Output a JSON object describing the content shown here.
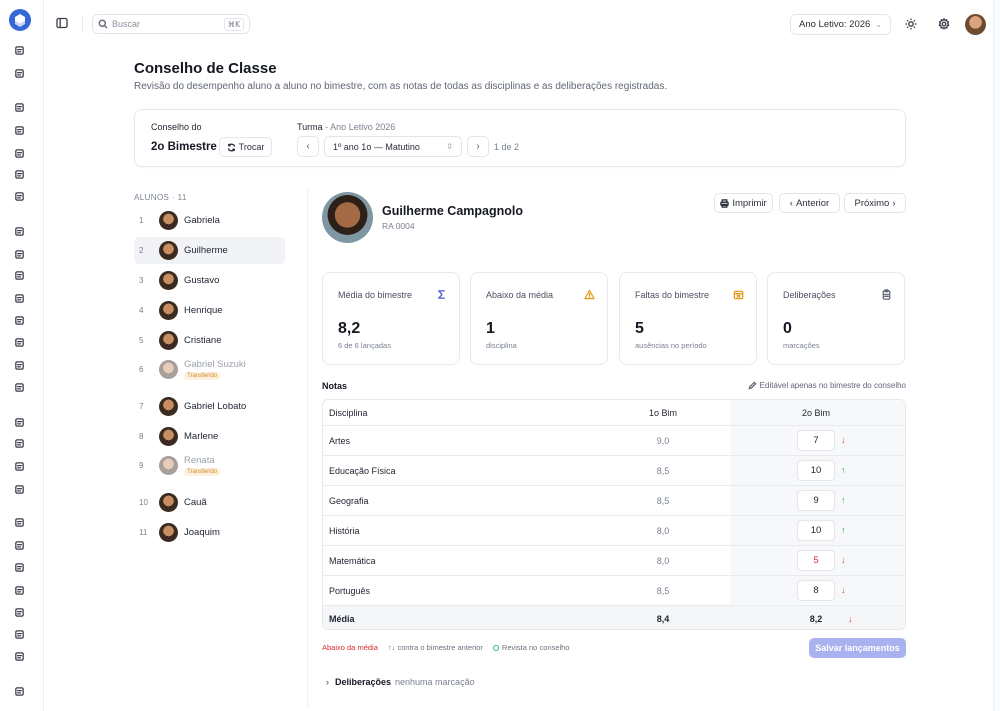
{
  "topbar": {
    "search_placeholder": "Buscar",
    "search_shortcut": "⌘K",
    "year_select": "Ano Letivo: 2026"
  },
  "header": {
    "title": "Conselho de Classe",
    "subtitle": "Revisão do desempenho aluno a aluno no bimestre, com as notas de todas as disciplinas e as deliberações registradas."
  },
  "context": {
    "conselho_label": "Conselho do",
    "conselho_value": "2o Bimestre",
    "swap_label": "Trocar",
    "turma_label": "Turma",
    "turma_suffix": " - Ano Letivo 2026",
    "turma_select": "1º ano 1o — Matutino",
    "page_count": "1 de 2"
  },
  "students": {
    "heading": "ALUNOS · 11",
    "items": [
      {
        "num": "1",
        "name": "Gabriela"
      },
      {
        "num": "2",
        "name": "Guilherme"
      },
      {
        "num": "3",
        "name": "Gustavo"
      },
      {
        "num": "4",
        "name": "Henrique"
      },
      {
        "num": "5",
        "name": "Cristiane"
      },
      {
        "num": "6",
        "name": "Gabriel Suzuki",
        "badge": "Transferido"
      },
      {
        "num": "7",
        "name": "Gabriel Lobato"
      },
      {
        "num": "8",
        "name": "Marlene"
      },
      {
        "num": "9",
        "name": "Renata",
        "badge": "Transferido"
      },
      {
        "num": "10",
        "name": "Cauã"
      },
      {
        "num": "11",
        "name": "Joaquim"
      }
    ]
  },
  "student": {
    "name": "Guilherme Campagnolo",
    "ra": "RA 0004",
    "print_label": "Imprimir",
    "prev_label": "Anterior",
    "next_label": "Próximo"
  },
  "metrics": [
    {
      "title": "Média do bimestre",
      "value": "8,2",
      "sub": "6 de 6 lançadas",
      "icon": "sigma-icon",
      "color": "#4a56c8"
    },
    {
      "title": "Abaixo da média",
      "value": "1",
      "sub": "disciplina",
      "icon": "warning-icon",
      "color": "#e59a1c"
    },
    {
      "title": "Faltas do bimestre",
      "value": "5",
      "sub": "ausências no período",
      "icon": "calendar-x-icon",
      "color": "#e59a1c"
    },
    {
      "title": "Deliberações",
      "value": "0",
      "sub": "marcações",
      "icon": "clipboard-icon",
      "color": "#5f6675"
    }
  ],
  "grades": {
    "title": "Notas",
    "hint": "Editável apenas no bimestre do conselho",
    "headers": {
      "discipline": "Disciplina",
      "b1": "1o Bim",
      "b2": "2o Bim"
    },
    "rows": [
      {
        "discipline": "Artes",
        "b1": "9,0",
        "b2": "7",
        "trend": "↓",
        "dir": "down",
        "low": false
      },
      {
        "discipline": "Educação Física",
        "b1": "8,5",
        "b2": "10",
        "trend": "↑",
        "dir": "up",
        "low": false
      },
      {
        "discipline": "Geografia",
        "b1": "8,5",
        "b2": "9",
        "trend": "↑",
        "dir": "up",
        "low": false
      },
      {
        "discipline": "História",
        "b1": "8,0",
        "b2": "10",
        "trend": "↑",
        "dir": "up",
        "low": false
      },
      {
        "discipline": "Matemática",
        "b1": "8,0",
        "b2": "5",
        "trend": "↓",
        "dir": "down",
        "low": true
      },
      {
        "discipline": "Português",
        "b1": "8,5",
        "b2": "8",
        "trend": "↓",
        "dir": "down",
        "low": false
      }
    ],
    "average": {
      "label": "Média",
      "b1": "8,4",
      "b2": "8,2",
      "trend": "↓"
    }
  },
  "legend": {
    "below": "Abaixo da média",
    "trend": "↑↓ contra o bimestre anterior",
    "reviewed": "Revista no conselho"
  },
  "save_label": "Salvar lançamentos",
  "deliberations": {
    "label": "Deliberações",
    "empty": "nenhuma marcação"
  },
  "colors": {
    "accent": "#4a56c8",
    "danger": "#d92d2d",
    "success": "#23a26d",
    "warning": "#e59a1c"
  }
}
